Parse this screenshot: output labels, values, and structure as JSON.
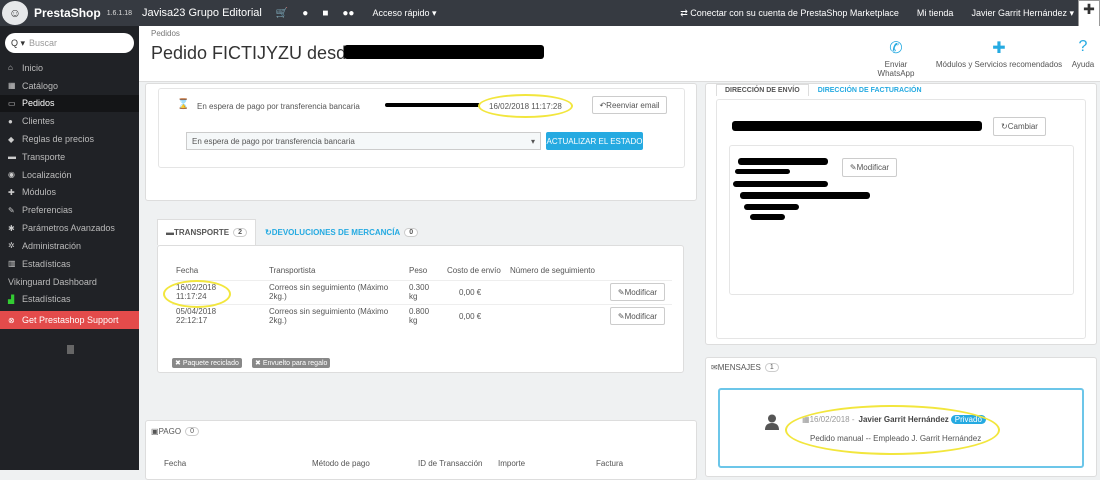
{
  "topbar": {
    "brand": "PrestaShop",
    "version": "1.6.1.18",
    "shop": "Javisa23 Grupo Editorial",
    "quick": "Acceso rápido ▾",
    "marketplace": "Conectar con su cuenta de PrestaShop Marketplace",
    "my_shop": "Mi tienda",
    "user": "Javier Garrit Hernández ▾"
  },
  "sidebar": {
    "search_placeholder": "Buscar",
    "items": [
      {
        "label": "Inicio",
        "icon": "home-icon"
      },
      {
        "label": "Catálogo",
        "icon": "catalog-icon"
      },
      {
        "label": "Pedidos",
        "icon": "orders-icon"
      },
      {
        "label": "Clientes",
        "icon": "customers-icon"
      },
      {
        "label": "Reglas de precios",
        "icon": "price-rules-icon"
      },
      {
        "label": "Transporte",
        "icon": "truck-icon"
      },
      {
        "label": "Localización",
        "icon": "globe-icon"
      },
      {
        "label": "Módulos",
        "icon": "puzzle-icon"
      },
      {
        "label": "Preferencias",
        "icon": "wrench-icon"
      },
      {
        "label": "Parámetros Avanzados",
        "icon": "cogs-icon"
      },
      {
        "label": "Administración",
        "icon": "gear-icon"
      },
      {
        "label": "Estadísticas",
        "icon": "chart-icon"
      },
      {
        "label": "Vikinguard Dashboard",
        "icon": ""
      },
      {
        "label": "Estadísticas",
        "icon": "graph-icon"
      },
      {
        "label": "Get Prestashop Support",
        "icon": "alert-icon"
      }
    ]
  },
  "header": {
    "breadcrumb": "Pedidos",
    "title": "Pedido FICTIJYZU desde",
    "toolbar": {
      "whatsapp": "Enviar WhatsApp",
      "modules": "Módulos y Servicios recomendados",
      "help": "Ayuda"
    }
  },
  "status": {
    "current": "En espera de pago por transferencia bancaria",
    "date": "16/02/2018 11:17:28",
    "resend": "Reenviar email",
    "select_value": "En espera de pago por transferencia bancaria",
    "update": "ACTUALIZAR EL ESTADO"
  },
  "shipping_tabs": {
    "transport": "TRANSPORTE",
    "transport_count": "2",
    "returns": "DEVOLUCIONES DE MERCANCÍA",
    "returns_count": "0"
  },
  "shipping_table": {
    "headers": [
      "Fecha",
      "Transportista",
      "Peso",
      "Costo de envío",
      "Número de seguimiento"
    ],
    "rows": [
      {
        "date": "16/02/2018",
        "time": "11:17:24",
        "carrier": "Correos sin seguimiento (Máximo",
        "carrier2": "2kg.)",
        "weight": "0.300",
        "weight_unit": "kg",
        "cost": "0,00 €",
        "action": "Modificar"
      },
      {
        "date": "05/04/2018",
        "time": "22:12:17",
        "carrier": "Correos sin seguimiento (Máximo",
        "carrier2": "2kg.)",
        "weight": "0.800",
        "weight_unit": "kg",
        "cost": "0,00 €",
        "action": "Modificar"
      }
    ]
  },
  "tags": {
    "recycled": "Paquete reciclado",
    "gift": "Envuelto para regalo"
  },
  "payment": {
    "title": "PAGO",
    "count": "0",
    "headers": [
      "Fecha",
      "Método de pago",
      "ID de Transacción",
      "Importe",
      "Factura"
    ]
  },
  "address": {
    "tab_shipping": "DIRECCIÓN DE ENVÍO",
    "tab_billing": "DIRECCIÓN DE FACTURACIÓN",
    "change": "Cambiar",
    "modify": "Modificar"
  },
  "messages": {
    "title": "MENSAJES",
    "count": "1",
    "date": "16/02/2018 -",
    "author": "Javier Garrit Hernández",
    "private": "Privado",
    "text": "Pedido manual -- Empleado J. Garrit Hernández"
  },
  "colors": {
    "accent": "#25aae1",
    "highlight": "#f2e63d",
    "sidebar": "#202226",
    "topbar": "#363a41",
    "support": "#e34b4b"
  }
}
